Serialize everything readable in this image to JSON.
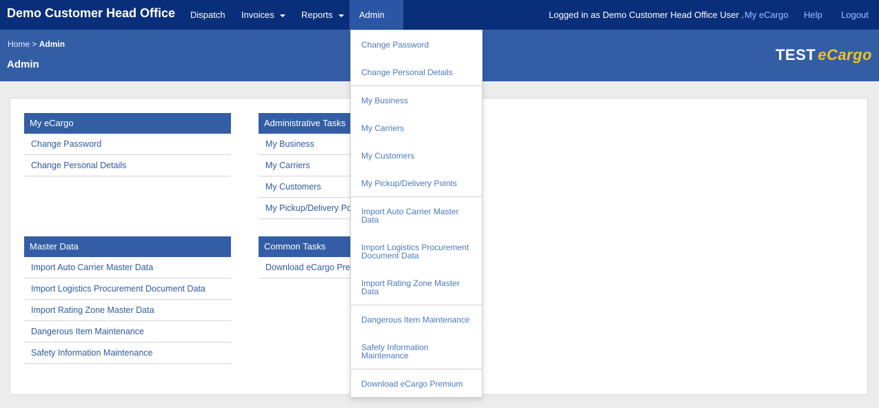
{
  "navbar": {
    "brand": "Demo Customer Head Office",
    "items": [
      {
        "label": "Dispatch",
        "caret": false
      },
      {
        "label": "Invoices",
        "caret": true
      },
      {
        "label": "Reports",
        "caret": true
      },
      {
        "label": "Admin",
        "caret": true
      }
    ],
    "logged_in": "Logged in as Demo Customer Head Office User .",
    "links": [
      "My eCargo",
      "Help",
      "Logout"
    ]
  },
  "header": {
    "breadcrumb_home": "Home",
    "breadcrumb_sep": " > ",
    "breadcrumb_current": "Admin",
    "title": "Admin",
    "logo_test": "TEST",
    "logo_ecargo": "eCargo"
  },
  "panels": {
    "my_ecargo": {
      "title": "My eCargo",
      "items": [
        "Change Password",
        "Change Personal Details"
      ]
    },
    "admin_tasks": {
      "title": "Administrative Tasks",
      "items": [
        "My Business",
        "My Carriers",
        "My Customers",
        "My Pickup/Delivery Points"
      ]
    },
    "master_data": {
      "title": "Master Data",
      "items": [
        "Import Auto Carrier Master Data",
        "Import Logistics Procurement Document Data",
        "Import Rating Zone Master Data",
        "Dangerous Item Maintenance",
        "Safety Information Maintenance"
      ]
    },
    "common_tasks": {
      "title": "Common Tasks",
      "items": [
        "Download eCargo Premium"
      ]
    }
  },
  "dropdown": {
    "items": [
      {
        "line1": "Change Password",
        "line2": ""
      },
      {
        "line1": "Change Personal Details",
        "line2": ""
      },
      {
        "line1": "My Business",
        "line2": ""
      },
      {
        "line1": "My Carriers",
        "line2": ""
      },
      {
        "line1": "My Customers",
        "line2": ""
      },
      {
        "line1": "My Pickup/Delivery Points",
        "line2": ""
      },
      {
        "line1": "Import Auto Carrier Master",
        "line2": "Data"
      },
      {
        "line1": "Import Logistics Procurement",
        "line2": "Document Data"
      },
      {
        "line1": "Import Rating Zone Master",
        "line2": "Data"
      },
      {
        "line1": "Dangerous Item Maintenance",
        "line2": ""
      },
      {
        "line1": "Safety Information",
        "line2": "Maintenance"
      },
      {
        "line1": "Download eCargo Premium",
        "line2": ""
      }
    ]
  }
}
